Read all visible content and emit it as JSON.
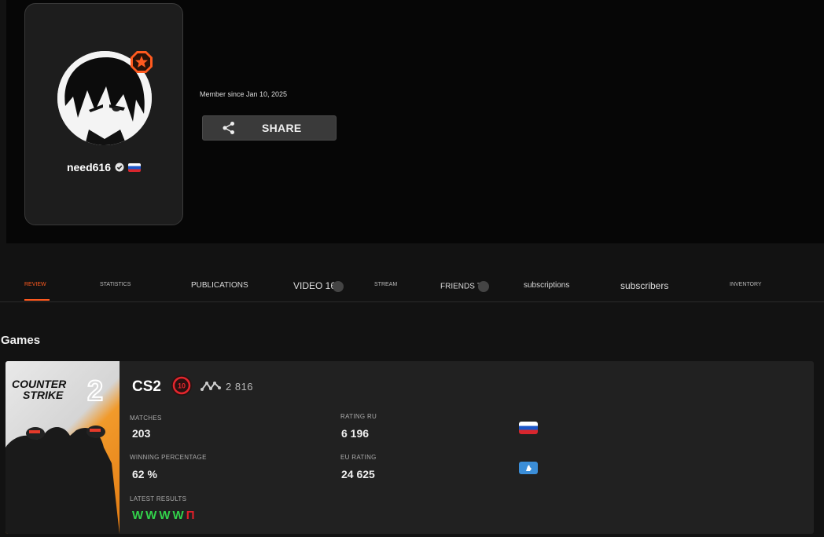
{
  "profile": {
    "username": "need616",
    "member_since": "Member since Jan 10, 2025",
    "share_label": "SHARE"
  },
  "tabs": [
    {
      "label": "REVIEW"
    },
    {
      "label": "STATISTICS"
    },
    {
      "label": "PUBLICATIONS"
    },
    {
      "label": "VIDEO 16"
    },
    {
      "label": "STREAM"
    },
    {
      "label": "FRIENDS 7"
    },
    {
      "label": "subscriptions"
    },
    {
      "label": "subscribers"
    },
    {
      "label": "INVENTORY"
    }
  ],
  "games_heading": "Games",
  "game": {
    "art_line1": "COUNTER",
    "art_line2": "STRIKE",
    "art_number": "2",
    "name": "CS2",
    "level": "10",
    "elo": "2 816",
    "matches_label": "MATCHES",
    "matches_value": "203",
    "win_label": "WINNING PERCENTAGE",
    "win_value": "62 %",
    "rating_ru_label": "RATING RU",
    "rating_ru_value": "6 196",
    "eu_label": "EU RATING",
    "eu_value": "24 625",
    "latest_label": "LATEST RESULTS",
    "latest_results": [
      "W",
      "W",
      "W",
      "W",
      "П"
    ]
  },
  "colors": {
    "accent": "#ff5a1f",
    "win": "#32d24b",
    "loss": "#e0202a",
    "card_bg": "#212121"
  }
}
